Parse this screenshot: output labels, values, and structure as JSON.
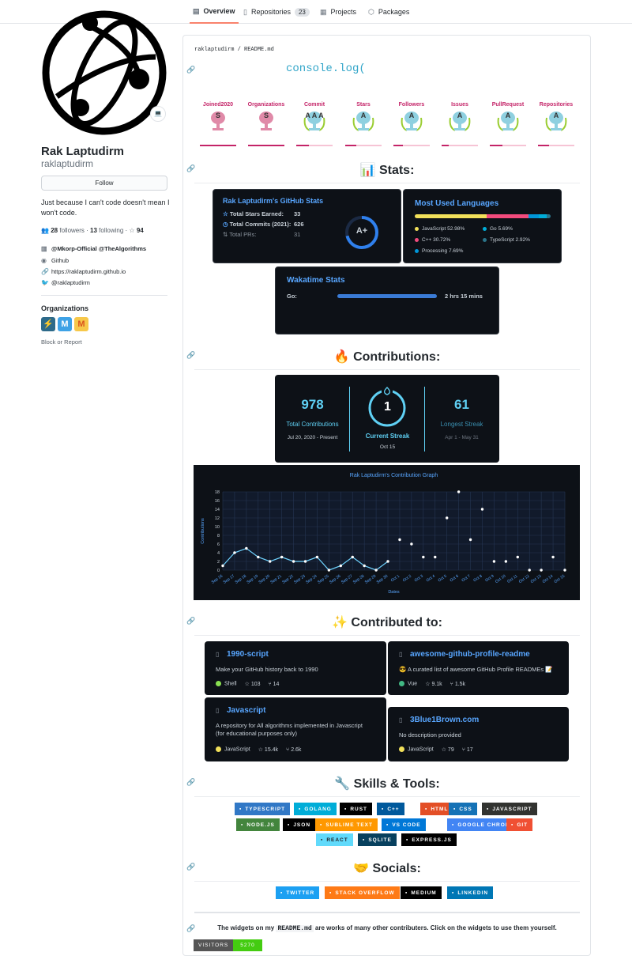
{
  "tabs": [
    {
      "label": "Overview",
      "icon": "book-icon"
    },
    {
      "label": "Repositories",
      "icon": "repo-icon",
      "count": "23"
    },
    {
      "label": "Projects",
      "icon": "project-icon"
    },
    {
      "label": "Packages",
      "icon": "package-icon"
    }
  ],
  "profile": {
    "name": "Rak Laptudirm",
    "login": "raklaptudirm",
    "follow_label": "Follow",
    "bio": "Just because I can't code doesn't mean I won't code.",
    "followers_count": "28",
    "followers_label": "followers",
    "following_count": "13",
    "following_label": "following",
    "stars_count": "94",
    "company": "@Mkorp-Official @TheAlgorithms",
    "location": "Github",
    "website": "https://raklaptudirm.github.io",
    "twitter": "@raklaptudirm",
    "organizations_title": "Organizations",
    "block_label": "Block or Report"
  },
  "readme": {
    "path_owner": "raklaptudirm",
    "path_sep": " / ",
    "path_file": "README.md",
    "console": "console.log(",
    "trophies": [
      {
        "title": "Joined2020",
        "rank": "S",
        "fill": 1.0
      },
      {
        "title": "Organizations",
        "rank": "S",
        "fill": 1.0
      },
      {
        "title": "Commit",
        "rank": "AAA",
        "fill": 0.35
      },
      {
        "title": "Stars",
        "rank": "A",
        "fill": 0.3
      },
      {
        "title": "Followers",
        "rank": "A",
        "fill": 0.25
      },
      {
        "title": "Issues",
        "rank": "A",
        "fill": 0.2
      },
      {
        "title": "PullRequest",
        "rank": "A",
        "fill": 0.35
      },
      {
        "title": "Repositories",
        "rank": "A",
        "fill": 0.3
      }
    ],
    "stats_heading": "📊 Stats:",
    "gh_stats": {
      "title": "Rak Laptudirm's GitHub Stats",
      "rows": [
        {
          "label": "Total Stars Earned:",
          "value": "33"
        },
        {
          "label": "Total Commits (2021):",
          "value": "626"
        },
        {
          "label": "Total PRs:",
          "value": "31"
        }
      ],
      "grade": "A+"
    },
    "languages": {
      "title": "Most Used Languages",
      "items": [
        {
          "name": "JavaScript 52.98%",
          "color": "#f1e05a",
          "pct": 52.98
        },
        {
          "name": "C++ 30.72%",
          "color": "#f34b7d",
          "pct": 30.72
        },
        {
          "name": "Processing 7.69%",
          "color": "#0096d8",
          "pct": 7.69
        },
        {
          "name": "Go 5.69%",
          "color": "#00add8",
          "pct": 5.69
        },
        {
          "name": "TypeScript 2.92%",
          "color": "#2b7489",
          "pct": 2.92
        }
      ]
    },
    "wakatime": {
      "title": "Wakatime Stats",
      "lang": "Go:",
      "time": "2 hrs 15 mins"
    },
    "contrib_heading": "🔥 Contributions:",
    "streak": {
      "total": "978",
      "total_label": "Total Contributions",
      "total_range": "Jul 20, 2020 - Present",
      "current": "1",
      "current_label": "Current Streak",
      "current_date": "Oct 15",
      "longest": "61",
      "longest_label": "Longest Streak",
      "longest_range": "Apr 1 - May 31"
    },
    "contributed_heading": "✨ Contributed to:",
    "repos": [
      {
        "name": "1990-script",
        "desc": "Make your GitHub history back to 1990",
        "lang": "Shell",
        "color": "#89e051",
        "stars": "103",
        "forks": "14"
      },
      {
        "name": "awesome-github-profile-readme",
        "desc": "😎 A curated list of awesome GitHub Profile READMEs 📝",
        "lang": "Vue",
        "color": "#41b883",
        "stars": "9.1k",
        "forks": "1.5k"
      },
      {
        "name": "Javascript",
        "desc": "A repository for All algorithms implemented in Javascript",
        "desc2": "(for educational purposes only)",
        "lang": "JavaScript",
        "color": "#f1e05a",
        "stars": "15.4k",
        "forks": "2.6k"
      },
      {
        "name": "3Blue1Brown.com",
        "desc": "No description provided",
        "lang": "JavaScript",
        "color": "#f1e05a",
        "stars": "79",
        "forks": "17"
      }
    ],
    "skills_heading": "🔧 Skills & Tools:",
    "skills": [
      [
        "TYPESCRIPT",
        "GOLANG",
        "RUST",
        "C++",
        "HTML",
        "CSS",
        "JAVASCRIPT"
      ],
      [
        "NODE.JS",
        "JSON",
        "SUBLIME TEXT",
        "VS CODE",
        "GOOGLE CHROME",
        "GIT"
      ],
      [
        "REACT",
        "SQLITE",
        "EXPRESS.JS"
      ]
    ],
    "socials_heading": "🤝 Socials:",
    "socials": [
      "TWITTER",
      "STACK OVERFLOW",
      "MEDIUM",
      "LINKEDIN"
    ],
    "footer_pre": "The widgets on my ",
    "footer_code": "README.md",
    "footer_post": " are works of many other contributers. Click on the widgets to use them yourself.",
    "visitors_label": "VISITORS",
    "visitors_count": "5270"
  },
  "chart_data": {
    "type": "line",
    "title": "Rak Laptudirm's Contribution Graph",
    "xlabel": "Dates",
    "ylabel": "Contributions",
    "ylim": [
      0,
      18
    ],
    "yticks": [
      0,
      2,
      4,
      6,
      8,
      10,
      12,
      14,
      16,
      18
    ],
    "categories": [
      "Sep 16",
      "Sep 17",
      "Sep 18",
      "Sep 19",
      "Sep 20",
      "Sep 21",
      "Sep 22",
      "Sep 23",
      "Sep 24",
      "Sep 25",
      "Sep 26",
      "Sep 27",
      "Sep 28",
      "Sep 29",
      "Sep 30",
      "Oct 1",
      "Oct 2",
      "Oct 3",
      "Oct 4",
      "Oct 5",
      "Oct 6",
      "Oct 7",
      "Oct 8",
      "Oct 9",
      "Oct 10",
      "Oct 11",
      "Oct 12",
      "Oct 13",
      "Oct 14",
      "Oct 15"
    ],
    "values": [
      1,
      4,
      5,
      3,
      2,
      3,
      2,
      2,
      3,
      0,
      1,
      3,
      1,
      0,
      2,
      7,
      6,
      3,
      3,
      12,
      18,
      7,
      14,
      2,
      2,
      3,
      0,
      0,
      3,
      0
    ],
    "grid": true
  },
  "colors": {
    "accent": "#58a6ff",
    "dark": "#0d1117",
    "trophy": "#c42468",
    "streak": "#5fd0f4"
  }
}
